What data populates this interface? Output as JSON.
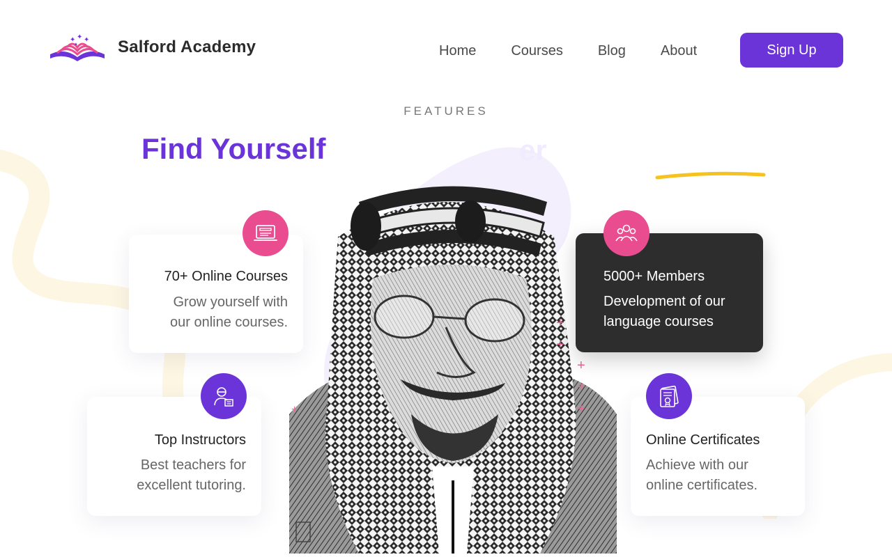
{
  "header": {
    "brand": "Salford Academy",
    "nav": [
      "Home",
      "Courses",
      "Blog",
      "About"
    ],
    "signup_label": "Sign Up"
  },
  "section": {
    "kicker": "FEATURES",
    "heading": "Find Yourself",
    "heading_tail": "er"
  },
  "features": [
    {
      "title": "70+ Online Courses",
      "desc_line1": "Grow yourself with",
      "desc_line2": "our online courses.",
      "icon": "online-course-icon"
    },
    {
      "title": "5000+ Members",
      "desc_line1": "Development of our",
      "desc_line2": "language courses",
      "icon": "members-icon"
    },
    {
      "title": "Top Instructors",
      "desc_line1": "Best teachers for",
      "desc_line2": "excellent tutoring.",
      "icon": "instructor-icon"
    },
    {
      "title": "Online Certificates",
      "desc_line1": "Achieve with our",
      "desc_line2": "online certificates.",
      "icon": "certificate-icon"
    }
  ],
  "colors": {
    "accent": "#6b34d8",
    "pink": "#ea4d8f",
    "yellow": "#f5c220",
    "dark_card": "#2d2d2d"
  }
}
